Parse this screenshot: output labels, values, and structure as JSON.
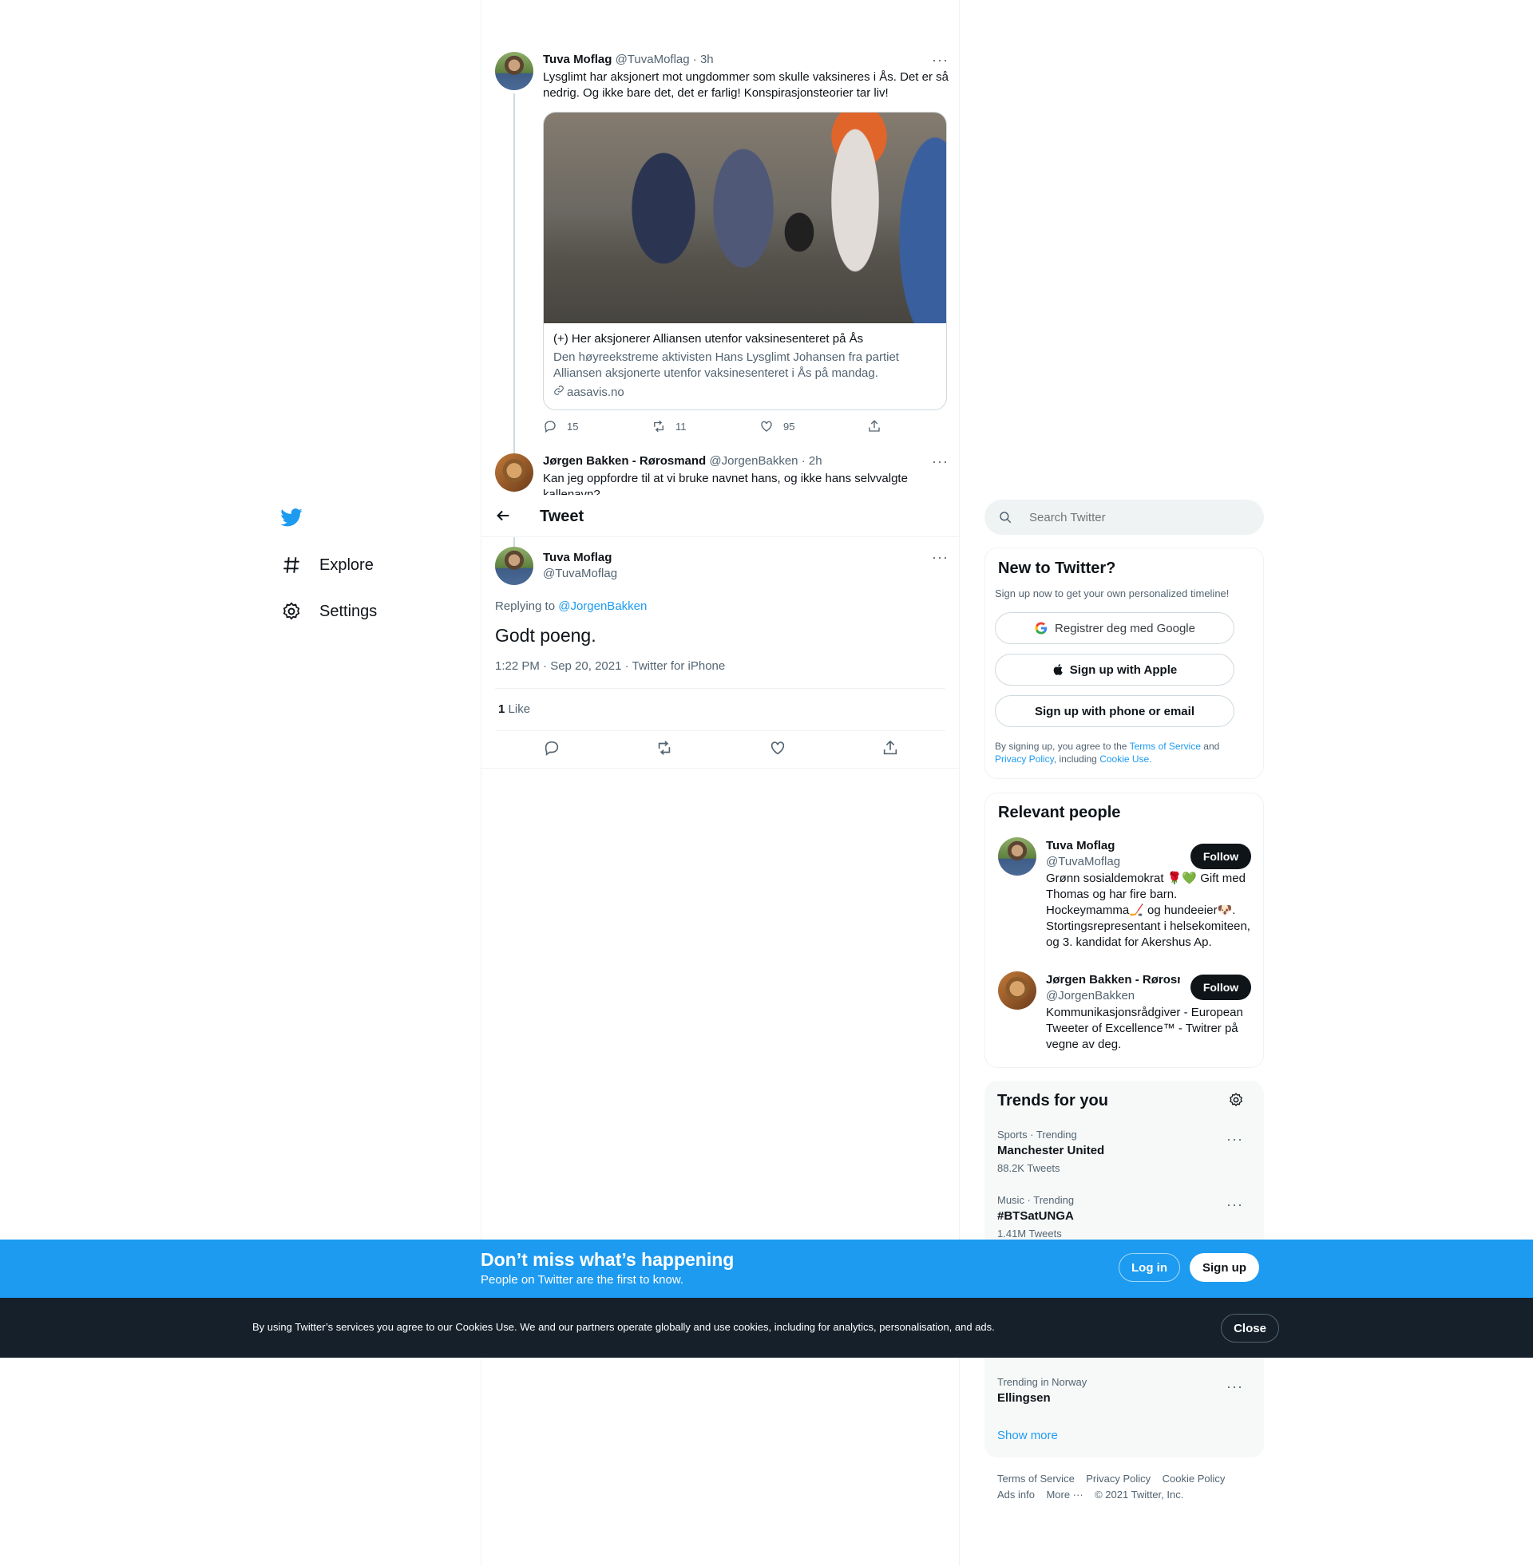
{
  "thread": {
    "tweet1": {
      "name": "Tuva Moflag",
      "handle": "@TuvaMoflag",
      "time": "· 3h",
      "text_line1": "Lysglimt har aksjonert mot ungdommer som skulle vaksineres i Ås. Det er så",
      "text_line2": "nedrig. Og ikke bare det, det er farlig! Konspirasjonsteorier tar liv!",
      "card_title": "(+) Her aksjonerer Alliansen utenfor vaksinesenteret på Ås",
      "card_desc_line1": "Den høyreekstreme aktivisten Hans Lysglimt Johansen fra partiet",
      "card_desc_line2": "Alliansen aksjonerte utenfor vaksinesenteret i Ås på mandag.",
      "card_domain": "aasavis.no",
      "replies": "15",
      "retweets": "11",
      "likes": "95"
    },
    "tweet2": {
      "name": "Jørgen Bakken - Rørosmand",
      "handle": "@JorgenBakken",
      "time": "· 2h",
      "text_line1": "Kan jeg oppfordre til at vi bruke navnet hans, og ikke hans selvvalgte",
      "text_line2": "kallenavn?"
    }
  },
  "header": {
    "title": "Tweet"
  },
  "nav": {
    "explore": "Explore",
    "settings": "Settings"
  },
  "main_tweet": {
    "name": "Tuva Moflag",
    "handle": "@TuvaMoflag",
    "replying_prefix": "Replying to",
    "replying_to": "@JorgenBakken",
    "text": "Godt poeng.",
    "meta": "1:22 PM · Sep 20, 2021 · Twitter for iPhone",
    "like_count": "1",
    "like_label": "Like"
  },
  "search": {
    "placeholder": "Search Twitter"
  },
  "new_to_twitter": {
    "title": "New to Twitter?",
    "subtitle": "Sign up now to get your own personalized timeline!",
    "google": "Registrer deg med Google",
    "apple": "Sign up with Apple",
    "phone": "Sign up with phone or email",
    "legal_prefix": "By signing up, you agree to the",
    "terms": "Terms of Service",
    "and": "and",
    "privacy": "Privacy Policy",
    "including": ", including",
    "cookie": "Cookie Use."
  },
  "relevant_people": {
    "title": "Relevant people",
    "people": [
      {
        "name": "Tuva Moflag",
        "handle": "@TuvaMoflag",
        "follow": "Follow",
        "bio_lines": [
          "Grønn sosialdemokrat 🌹💚 Gift med",
          "Thomas og har fire barn.",
          "Hockeymamma🏒 og hundeeier🐶.",
          "Stortingsrepresentant i helsekomiteen,",
          "og 3. kandidat for Akershus Ap."
        ]
      },
      {
        "name": "Jørgen Bakken - Rørosm",
        "handle": "@JorgenBakken",
        "follow": "Follow",
        "bio_lines": [
          "Kommunikasjonsrådgiver - European",
          "Tweeter of Excellence™ - Twitrer på",
          "vegne av deg."
        ]
      }
    ]
  },
  "trends": {
    "title": "Trends for you",
    "items": [
      {
        "category": "Sports · Trending",
        "name": "Manchester United",
        "count": "88.2K Tweets"
      },
      {
        "category": "Music · Trending",
        "name": "#BTSatUNGA",
        "count": "1.41M Tweets"
      },
      {
        "category": "Trending in Norway",
        "name": "Ellingsen",
        "count": ""
      }
    ],
    "show_more": "Show more"
  },
  "footer": {
    "terms": "Terms of Service",
    "privacy": "Privacy Policy",
    "cookie": "Cookie Policy",
    "ads": "Ads info",
    "more": "More ···",
    "copyright": "© 2021 Twitter, Inc."
  },
  "banner": {
    "title": "Don’t miss what’s happening",
    "subtitle": "People on Twitter are the first to know.",
    "login": "Log in",
    "signup": "Sign up"
  },
  "cookie_bar": {
    "text": "By using Twitter’s services you agree to our Cookies Use. We and our partners operate globally and use cookies, including for analytics, personalisation, and ads.",
    "close": "Close"
  },
  "colors": {
    "accent": "#1d9bf0",
    "banner_bg": "#1d9bf0",
    "cookie_bg": "#15202b",
    "text": "#0f1419",
    "muted": "#536471"
  }
}
